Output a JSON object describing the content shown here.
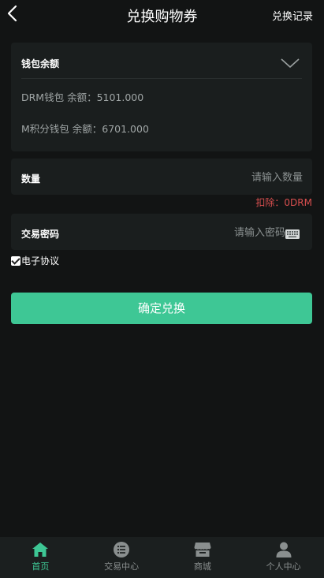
{
  "header": {
    "title": "兑换购物券",
    "record_link": "兑换记录"
  },
  "wallet": {
    "heading": "钱包余额",
    "rows": [
      "DRM钱包 余额：5101.000",
      "M积分钱包 余额：6701.000"
    ]
  },
  "quantity": {
    "label": "数量",
    "placeholder": "请输入数量"
  },
  "deduct_text": "扣除：0DRM",
  "password": {
    "label": "交易密码",
    "placeholder": "请输入密码"
  },
  "agreement": {
    "label": "电子协议",
    "checked": true
  },
  "confirm_button": "确定兑换",
  "tabbar": {
    "items": [
      {
        "label": "首页",
        "icon": "home-icon",
        "active": true
      },
      {
        "label": "交易中心",
        "icon": "list-icon",
        "active": false
      },
      {
        "label": "商城",
        "icon": "store-icon",
        "active": false
      },
      {
        "label": "个人中心",
        "icon": "user-icon",
        "active": false
      }
    ]
  },
  "colors": {
    "background": "#121414",
    "card": "#1a1e1e",
    "accent": "#3ec795",
    "deduct": "#d94f4f"
  }
}
